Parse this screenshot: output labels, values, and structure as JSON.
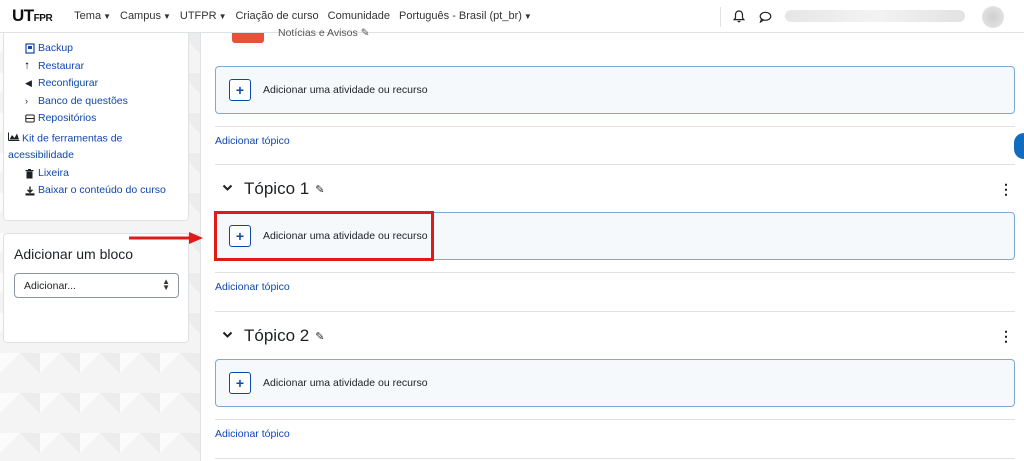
{
  "navbar": {
    "logo_main": "UT",
    "logo_small": "FPR",
    "links": [
      {
        "label": "Tema",
        "has_caret": true
      },
      {
        "label": "Campus",
        "has_caret": true
      },
      {
        "label": "UTFPR",
        "has_caret": true
      },
      {
        "label": "Criação de curso",
        "has_caret": false
      },
      {
        "label": "Comunidade",
        "has_caret": false
      },
      {
        "label": "Português - Brasil (pt_br)",
        "has_caret": true
      }
    ],
    "icons": [
      "bell-icon",
      "chat-icon"
    ]
  },
  "sidebar": {
    "admin_items": [
      {
        "label": "Backup",
        "icon": "backup-icon"
      },
      {
        "label": "Restaurar",
        "icon": "restore-icon"
      },
      {
        "label": "Reconfigurar",
        "icon": "reset-icon"
      },
      {
        "label": "Banco de questões",
        "icon": "chevron-right-icon"
      },
      {
        "label": "Repositórios",
        "icon": "repository-icon"
      },
      {
        "label": "Kit de ferramentas de acessibilidade",
        "icon": "chart-icon"
      },
      {
        "label": "Lixeira",
        "icon": "trash-icon"
      },
      {
        "label": "Baixar o conteúdo do curso",
        "icon": "download-icon"
      }
    ],
    "add_block": {
      "title": "Adicionar um bloco",
      "select_value": "Adicionar..."
    }
  },
  "main": {
    "partial_activity": "Notícias e Avisos",
    "add_activity_label": "Adicionar uma atividade ou recurso",
    "add_topic_label": "Adicionar tópico",
    "topics": [
      {
        "title": "Tópico 1"
      },
      {
        "title": "Tópico 2"
      }
    ]
  },
  "colors": {
    "link": "#0f47ad",
    "highlight": "#e01919",
    "box_border": "#7fa8d6",
    "box_bg": "#f5f9fc"
  }
}
